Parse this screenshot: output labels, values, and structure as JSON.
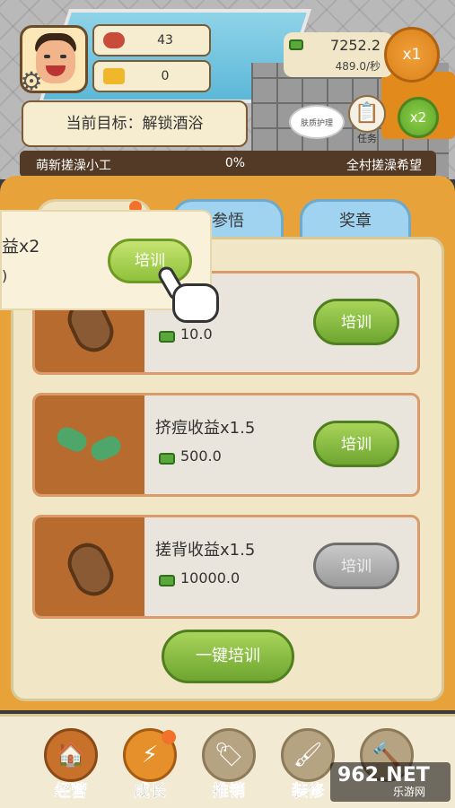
{
  "hud": {
    "meat_count": "43",
    "gold_count": "0",
    "goal_text": "当前目标：解锁酒浴",
    "money": "7252.2",
    "money_rate": "489.0/秒",
    "speed_x1": "x1",
    "speed_x2": "x2",
    "task_label": "任务",
    "bubble_text": "肤质护理"
  },
  "progress": {
    "left_label": "萌新搓澡小工",
    "percent": "0%",
    "right_label": "全村搓澡希望",
    "fraction": 0
  },
  "tabs": [
    {
      "label": ""
    },
    {
      "label": "参悟"
    },
    {
      "label": "奖章"
    }
  ],
  "popup": {
    "title": "益x2",
    "cost": ")",
    "button": "培训"
  },
  "cards": [
    {
      "title": "x2",
      "cost": "10.0",
      "button": "培训",
      "enabled": true
    },
    {
      "title": "挤痘收益x1.5",
      "cost": "500.0",
      "button": "培训",
      "enabled": true
    },
    {
      "title": "搓背收益x1.5",
      "cost": "10000.0",
      "button": "培训",
      "enabled": false
    }
  ],
  "one_key_button": "一键培训",
  "nav": [
    {
      "label": "经营",
      "icon": "shop-icon"
    },
    {
      "label": "成长",
      "icon": "lightning-icon"
    },
    {
      "label": "推销",
      "icon": "tag-icon"
    },
    {
      "label": "装修",
      "icon": "paint-roller-icon"
    },
    {
      "label": "",
      "icon": "hammer-icon"
    }
  ],
  "watermark": {
    "big": "962.NET",
    "small": "乐游网"
  },
  "colors": {
    "accent_orange": "#e8a23a",
    "button_green": "#8ec13a",
    "button_gray": "#9b9b9b",
    "progress_bg": "#523a26"
  }
}
